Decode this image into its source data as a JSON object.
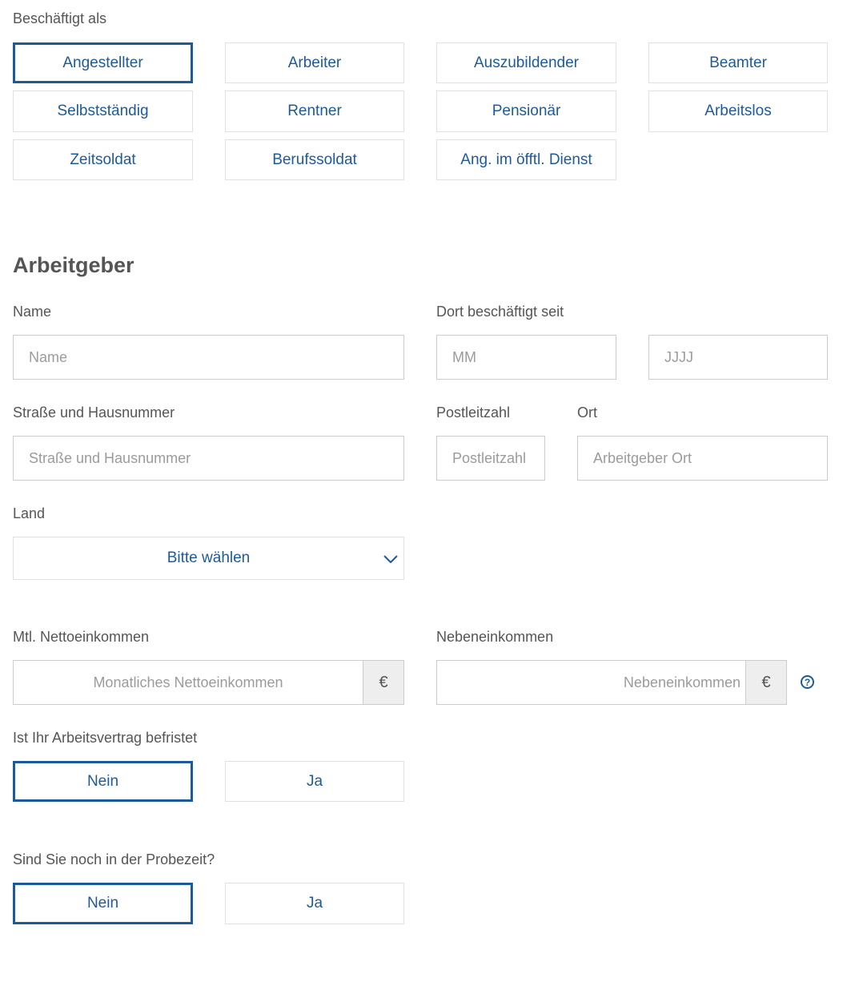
{
  "employment": {
    "label": "Beschäftigt als",
    "options": [
      "Angestellter",
      "Arbeiter",
      "Auszubildender",
      "Beamter",
      "Selbstständig",
      "Rentner",
      "Pensionär",
      "Arbeitslos",
      "Zeitsoldat",
      "Berufssoldat",
      "Ang. im öfftl. Dienst"
    ],
    "selected": "Angestellter"
  },
  "employer": {
    "heading": "Arbeitgeber",
    "name_label": "Name",
    "name_placeholder": "Name",
    "since_label": "Dort beschäftigt seit",
    "month_placeholder": "MM",
    "year_placeholder": "JJJJ",
    "street_label": "Straße und Hausnummer",
    "street_placeholder": "Straße und Hausnummer",
    "zip_label": "Postleitzahl",
    "zip_placeholder": "Postleitzahl",
    "city_label": "Ort",
    "city_placeholder": "Arbeitgeber Ort",
    "country_label": "Land",
    "country_value": "Bitte wählen"
  },
  "income": {
    "net_label": "Mtl. Nettoeinkommen",
    "net_placeholder": "Monatliches Nettoeinkommen",
    "side_label": "Nebeneinkommen",
    "side_placeholder": "Nebeneinkommen",
    "currency": "€",
    "help_symbol": "?"
  },
  "contract": {
    "label": "Ist Ihr Arbeitsvertrag befristet",
    "options": [
      "Nein",
      "Ja"
    ],
    "selected": "Nein"
  },
  "probation": {
    "label": "Sind Sie noch in der Probezeit?",
    "options": [
      "Nein",
      "Ja"
    ],
    "selected": "Nein"
  },
  "colors": {
    "accent": "#1d5a9a",
    "text": "#555555",
    "border": "#e1e1e1",
    "input_border": "#cccccc",
    "addon_bg": "#eeeeee"
  }
}
